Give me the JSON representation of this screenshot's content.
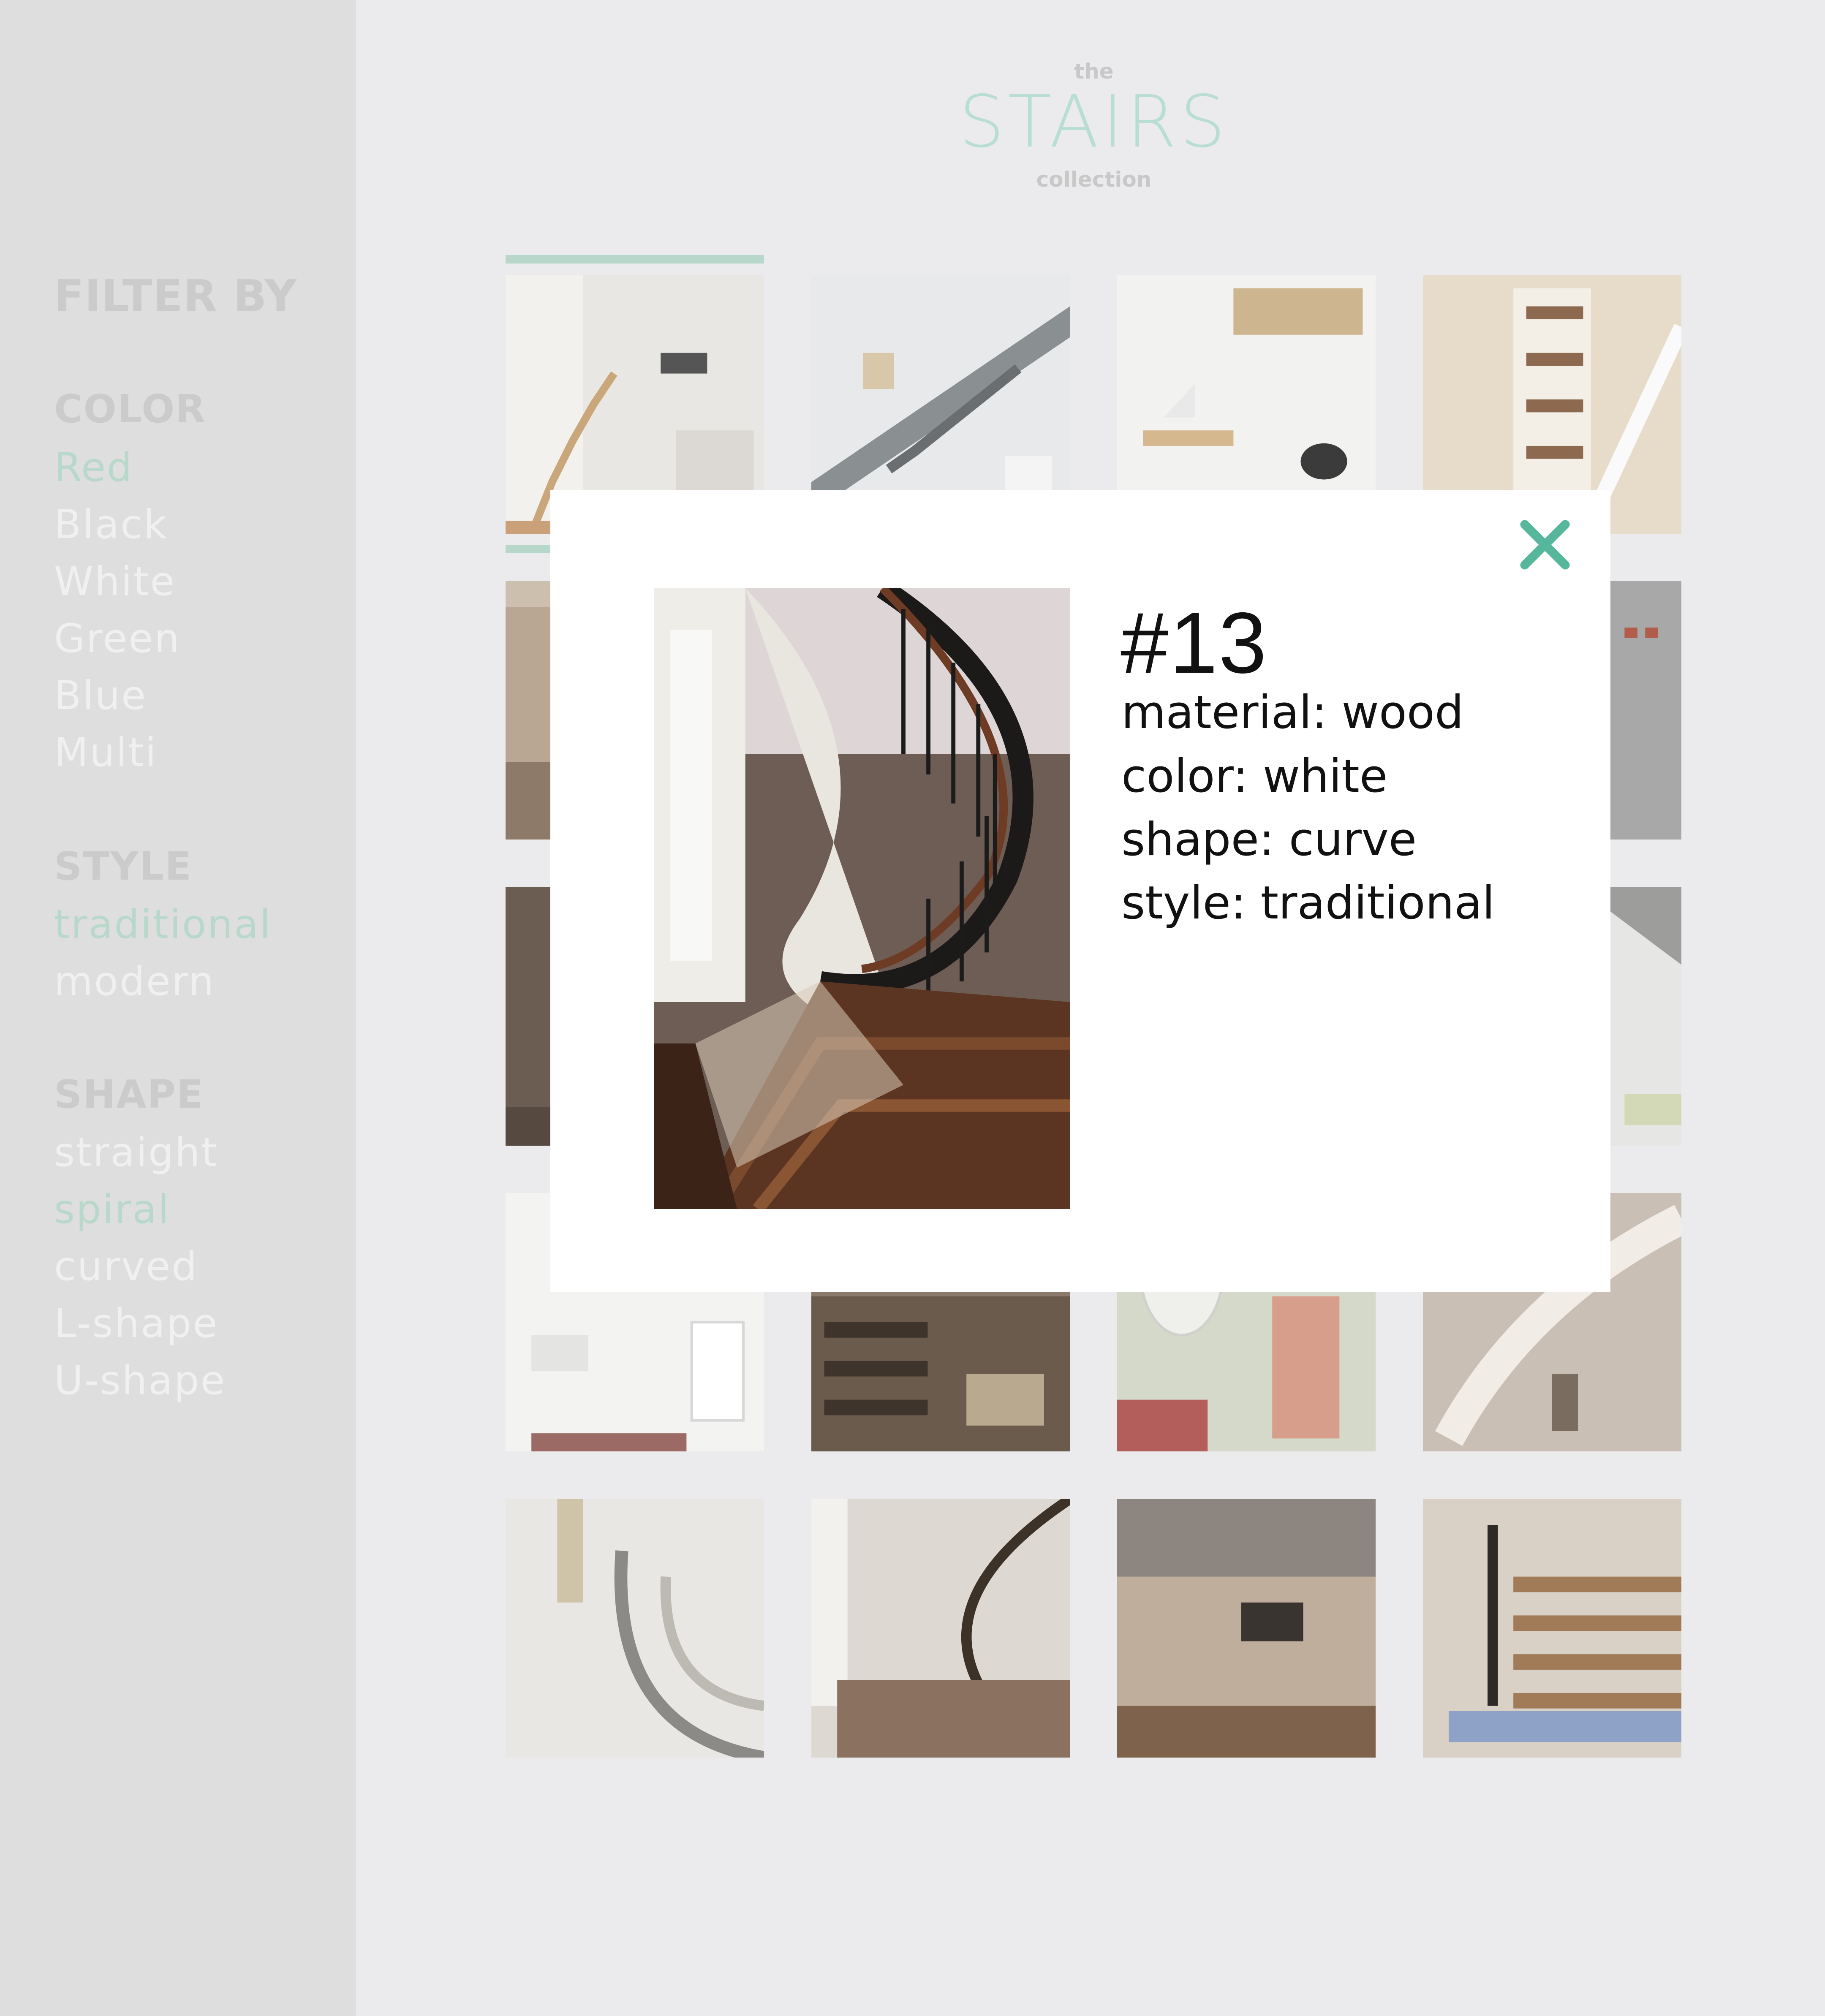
{
  "logo": {
    "top": "the",
    "main": "STAIRS",
    "bottom": "collection"
  },
  "sidebar": {
    "heading": "FILTER BY",
    "groups": [
      {
        "title": "COLOR",
        "options": [
          {
            "label": "Red",
            "active": true
          },
          {
            "label": "Black",
            "active": false
          },
          {
            "label": "White",
            "active": false
          },
          {
            "label": "Green",
            "active": false
          },
          {
            "label": "Blue",
            "active": false
          },
          {
            "label": "Multi",
            "active": false
          }
        ]
      },
      {
        "title": "STYLE",
        "options": [
          {
            "label": "traditional",
            "active": true
          },
          {
            "label": "modern",
            "active": false
          }
        ]
      },
      {
        "title": "SHAPE",
        "options": [
          {
            "label": "straight",
            "active": false
          },
          {
            "label": "spiral",
            "active": true
          },
          {
            "label": "curved",
            "active": false
          },
          {
            "label": "L-shape",
            "active": false
          },
          {
            "label": "U-shape",
            "active": false
          }
        ]
      }
    ]
  },
  "colors": {
    "accent": "#b7d7cb",
    "close": "#56b79d",
    "sidebar_bg": "#dedede",
    "page_bg": "#ebebed"
  },
  "modal": {
    "number": "#13",
    "attributes": [
      "material: wood",
      "color: white",
      "shape: curve",
      "style: traditional"
    ],
    "close_icon": "close-icon"
  }
}
